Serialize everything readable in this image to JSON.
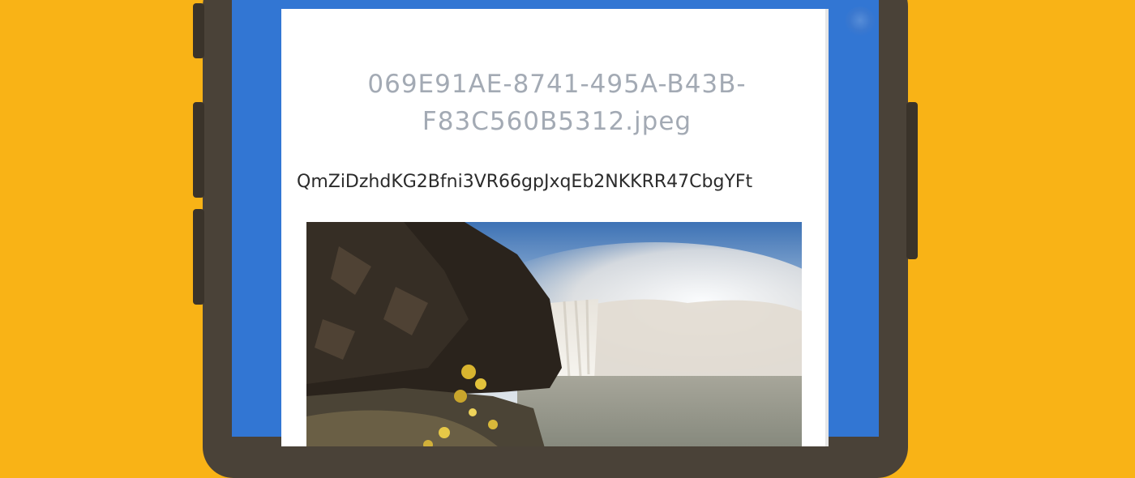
{
  "file": {
    "name": "069E91AE-8741-495A-B43B-F83C560B5312.jpeg",
    "hash": "QmZiDzhdKG2Bfni3VR66gpJxqEb2NKKRR47CbgYFt",
    "image_icon": "waterfall-photo"
  },
  "colors": {
    "background": "#F9B316",
    "phone_frame": "#4A4238",
    "screen": "#3276D3",
    "card": "#FFFFFF",
    "title_text": "#A3AAB4",
    "hash_text": "#2B2B2B"
  }
}
